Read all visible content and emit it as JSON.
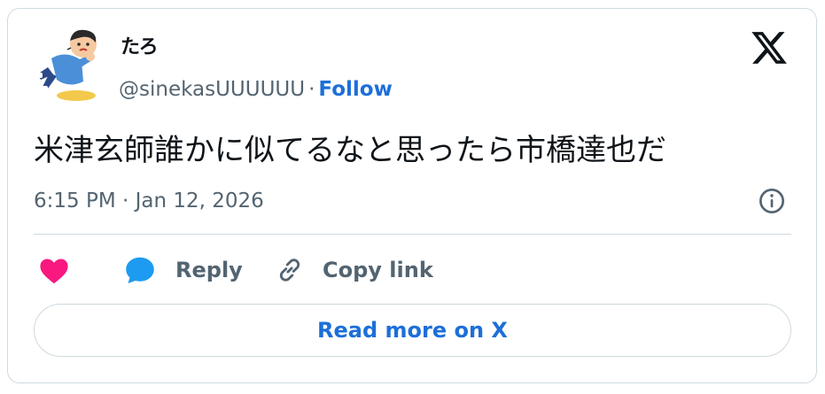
{
  "author": {
    "display_name": "たろ",
    "handle": "@sinekasUUUUUU",
    "separator": "·",
    "follow_label": "Follow"
  },
  "tweet": {
    "text": "米津玄師誰かに似てるなと思ったら市橋達也だ",
    "timestamp": "6:15 PM · Jan 12, 2026"
  },
  "actions": {
    "like_icon": "heart-icon",
    "reply_label": "Reply",
    "copy_link_label": "Copy link"
  },
  "footer": {
    "read_more_label": "Read more on X"
  },
  "colors": {
    "accent": "#1d6fd8",
    "like": "#f91880",
    "reply_icon": "#1d9bf0",
    "muted_text": "#536471",
    "border": "#cfd9de"
  }
}
